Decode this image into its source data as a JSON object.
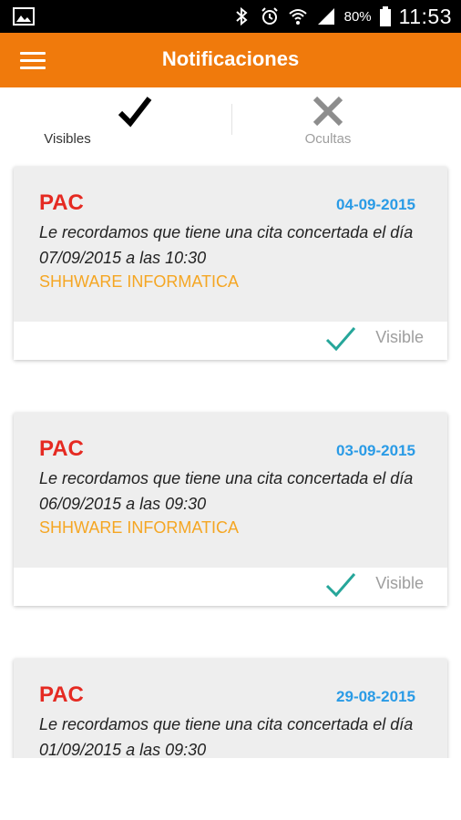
{
  "status_bar": {
    "battery": "80%",
    "time": "11:53",
    "icons": [
      "photo-notification-icon",
      "bluetooth-icon",
      "alarm-icon",
      "wifi-icon",
      "signal-icon",
      "battery-icon"
    ]
  },
  "app_bar": {
    "title": "Notificaciones",
    "menu_icon": "hamburger-menu-icon",
    "color": "#f07a0c"
  },
  "tabs": [
    {
      "label": "Visibles",
      "icon": "checkmark-icon",
      "active": true
    },
    {
      "label": "Ocultas",
      "icon": "x-icon",
      "active": false
    }
  ],
  "notifications": [
    {
      "title": "PAC",
      "date": "04-09-2015",
      "message": "Le recordamos que tiene una cita concertada el día 07/09/2015 a las 10:30",
      "company": "SHHWARE INFORMATICA",
      "status": "Visible"
    },
    {
      "title": "PAC",
      "date": "03-09-2015",
      "message": "Le recordamos que tiene una cita concertada el día 06/09/2015 a las 09:30",
      "company": "SHHWARE INFORMATICA",
      "status": "Visible"
    },
    {
      "title": "PAC",
      "date": "29-08-2015",
      "message": "Le recordamos que tiene una cita concertada el día 01/09/2015 a las 09:30",
      "company": "",
      "status": ""
    }
  ],
  "colors": {
    "title_red": "#e52a22",
    "date_blue": "#2a9be6",
    "company_orange": "#f5a623",
    "check_teal": "#26a69a"
  }
}
